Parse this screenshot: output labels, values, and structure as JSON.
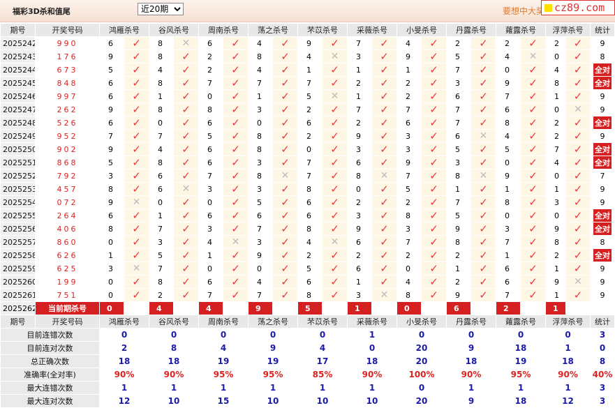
{
  "app_title": "福彩3D杀和值尾",
  "period_select": {
    "options": [
      "近20期"
    ],
    "selected": "近20期"
  },
  "promo_text": "要想中大奖",
  "logo_text": "cz89.com",
  "headers": [
    "期号",
    "开奖号码",
    "鸿雁杀号",
    "谷风杀号",
    "周南杀号",
    "荡之杀号",
    "芣苡杀号",
    "采薇杀号",
    "小旻杀号",
    "丹露杀号",
    "蕹露杀号",
    "浮萍杀号",
    "统计"
  ],
  "rows": [
    {
      "issue": "2025242",
      "draw": "990",
      "kills": [
        6,
        8,
        6,
        4,
        9,
        7,
        4,
        2,
        2,
        2
      ],
      "hits": [
        1,
        0,
        1,
        1,
        1,
        1,
        1,
        1,
        1,
        1
      ],
      "total": "9"
    },
    {
      "issue": "2025243",
      "draw": "176",
      "kills": [
        9,
        8,
        2,
        8,
        4,
        3,
        9,
        5,
        4,
        0
      ],
      "hits": [
        1,
        1,
        1,
        1,
        0,
        1,
        1,
        1,
        0,
        1
      ],
      "total": "8"
    },
    {
      "issue": "2025244",
      "draw": "673",
      "kills": [
        5,
        4,
        2,
        4,
        1,
        1,
        1,
        7,
        0,
        4
      ],
      "hits": [
        1,
        1,
        1,
        1,
        1,
        1,
        1,
        1,
        1,
        1
      ],
      "total": "全对"
    },
    {
      "issue": "2025245",
      "draw": "848",
      "kills": [
        6,
        8,
        7,
        7,
        7,
        2,
        2,
        3,
        9,
        8
      ],
      "hits": [
        1,
        1,
        1,
        1,
        1,
        1,
        1,
        1,
        1,
        1
      ],
      "total": "全对"
    },
    {
      "issue": "2025246",
      "draw": "997",
      "kills": [
        6,
        1,
        0,
        1,
        5,
        1,
        2,
        6,
        7,
        1
      ],
      "hits": [
        1,
        1,
        1,
        1,
        0,
        1,
        1,
        1,
        1,
        1
      ],
      "total": "9"
    },
    {
      "issue": "2025247",
      "draw": "262",
      "kills": [
        9,
        8,
        8,
        3,
        2,
        7,
        7,
        7,
        6,
        0
      ],
      "hits": [
        1,
        1,
        1,
        1,
        1,
        1,
        1,
        1,
        1,
        0
      ],
      "total": "9"
    },
    {
      "issue": "2025248",
      "draw": "526",
      "kills": [
        6,
        0,
        6,
        0,
        6,
        2,
        6,
        7,
        8,
        2
      ],
      "hits": [
        1,
        1,
        1,
        1,
        1,
        1,
        1,
        1,
        1,
        1
      ],
      "total": "全对"
    },
    {
      "issue": "2025249",
      "draw": "952",
      "kills": [
        7,
        7,
        5,
        8,
        2,
        9,
        3,
        6,
        4,
        2
      ],
      "hits": [
        1,
        1,
        1,
        1,
        1,
        1,
        1,
        0,
        1,
        1
      ],
      "total": "9"
    },
    {
      "issue": "2025250",
      "draw": "902",
      "kills": [
        9,
        4,
        6,
        8,
        0,
        3,
        3,
        5,
        5,
        7
      ],
      "hits": [
        1,
        1,
        1,
        1,
        1,
        1,
        1,
        1,
        1,
        1
      ],
      "total": "全对"
    },
    {
      "issue": "2025251",
      "draw": "868",
      "kills": [
        5,
        8,
        6,
        3,
        7,
        6,
        9,
        3,
        0,
        4
      ],
      "hits": [
        1,
        1,
        1,
        1,
        1,
        1,
        1,
        1,
        1,
        1
      ],
      "total": "全对"
    },
    {
      "issue": "2025252",
      "draw": "792",
      "kills": [
        3,
        6,
        7,
        8,
        7,
        8,
        7,
        8,
        9,
        0
      ],
      "hits": [
        1,
        1,
        1,
        0,
        1,
        0,
        1,
        0,
        1,
        1
      ],
      "total": "7"
    },
    {
      "issue": "2025253",
      "draw": "457",
      "kills": [
        8,
        6,
        3,
        3,
        8,
        0,
        5,
        1,
        1,
        1
      ],
      "hits": [
        1,
        0,
        1,
        1,
        1,
        1,
        1,
        1,
        1,
        1
      ],
      "total": "9"
    },
    {
      "issue": "2025254",
      "draw": "072",
      "kills": [
        9,
        0,
        0,
        5,
        6,
        2,
        2,
        7,
        8,
        3
      ],
      "hits": [
        0,
        1,
        1,
        1,
        1,
        1,
        1,
        1,
        1,
        1
      ],
      "total": "9"
    },
    {
      "issue": "2025255",
      "draw": "264",
      "kills": [
        6,
        1,
        6,
        6,
        6,
        3,
        8,
        5,
        0,
        0
      ],
      "hits": [
        1,
        1,
        1,
        1,
        1,
        1,
        1,
        1,
        1,
        1
      ],
      "total": "全对"
    },
    {
      "issue": "2025256",
      "draw": "406",
      "kills": [
        8,
        7,
        3,
        7,
        8,
        9,
        3,
        9,
        3,
        9
      ],
      "hits": [
        1,
        1,
        1,
        1,
        1,
        1,
        1,
        1,
        1,
        1
      ],
      "total": "全对"
    },
    {
      "issue": "2025257",
      "draw": "860",
      "kills": [
        0,
        3,
        4,
        3,
        4,
        6,
        7,
        8,
        7,
        8
      ],
      "hits": [
        1,
        1,
        0,
        1,
        0,
        1,
        1,
        1,
        1,
        1
      ],
      "total": "8"
    },
    {
      "issue": "2025258",
      "draw": "626",
      "kills": [
        1,
        5,
        1,
        9,
        2,
        2,
        2,
        2,
        1,
        2
      ],
      "hits": [
        1,
        1,
        1,
        1,
        1,
        1,
        1,
        1,
        1,
        1
      ],
      "total": "全对"
    },
    {
      "issue": "2025259",
      "draw": "625",
      "kills": [
        3,
        7,
        0,
        0,
        5,
        6,
        0,
        1,
        6,
        1
      ],
      "hits": [
        0,
        1,
        1,
        1,
        1,
        1,
        1,
        1,
        1,
        1
      ],
      "total": "9"
    },
    {
      "issue": "2025260",
      "draw": "199",
      "kills": [
        0,
        8,
        6,
        4,
        6,
        1,
        4,
        2,
        6,
        9
      ],
      "hits": [
        1,
        1,
        1,
        1,
        1,
        1,
        1,
        1,
        1,
        0
      ],
      "total": "9"
    },
    {
      "issue": "2025261",
      "draw": "751",
      "kills": [
        0,
        2,
        7,
        7,
        8,
        3,
        8,
        9,
        7,
        1
      ],
      "hits": [
        1,
        1,
        1,
        1,
        1,
        0,
        1,
        1,
        1,
        1
      ],
      "total": "9"
    }
  ],
  "current": {
    "issue": "2025262",
    "label": "当前期杀号",
    "kills": [
      "0",
      "4",
      "4",
      "9",
      "5",
      "1",
      "0",
      "6",
      "2",
      "1"
    ]
  },
  "stats": [
    {
      "label": "目前连错次数",
      "values": [
        "0",
        "0",
        "0",
        "0",
        "0",
        "1",
        "0",
        "0",
        "0",
        "0"
      ],
      "total": "3",
      "pct": false
    },
    {
      "label": "目前连对次数",
      "values": [
        "2",
        "8",
        "4",
        "9",
        "4",
        "0",
        "20",
        "9",
        "18",
        "1"
      ],
      "total": "0",
      "pct": false
    },
    {
      "label": "总正确次数",
      "values": [
        "18",
        "18",
        "19",
        "19",
        "17",
        "18",
        "20",
        "18",
        "19",
        "18"
      ],
      "total": "8",
      "pct": false
    },
    {
      "label": "准确率(全对率)",
      "values": [
        "90%",
        "90%",
        "95%",
        "95%",
        "85%",
        "90%",
        "100%",
        "90%",
        "95%",
        "90%"
      ],
      "total": "40%",
      "pct": true
    },
    {
      "label": "最大连错次数",
      "values": [
        "1",
        "1",
        "1",
        "1",
        "1",
        "1",
        "0",
        "1",
        "1",
        "1"
      ],
      "total": "3",
      "pct": false
    },
    {
      "label": "最大连对次数",
      "values": [
        "12",
        "10",
        "15",
        "10",
        "10",
        "10",
        "20",
        "9",
        "18",
        "12"
      ],
      "total": "3",
      "pct": false
    }
  ],
  "marks": {
    "hit": "✓",
    "miss": "✕"
  }
}
